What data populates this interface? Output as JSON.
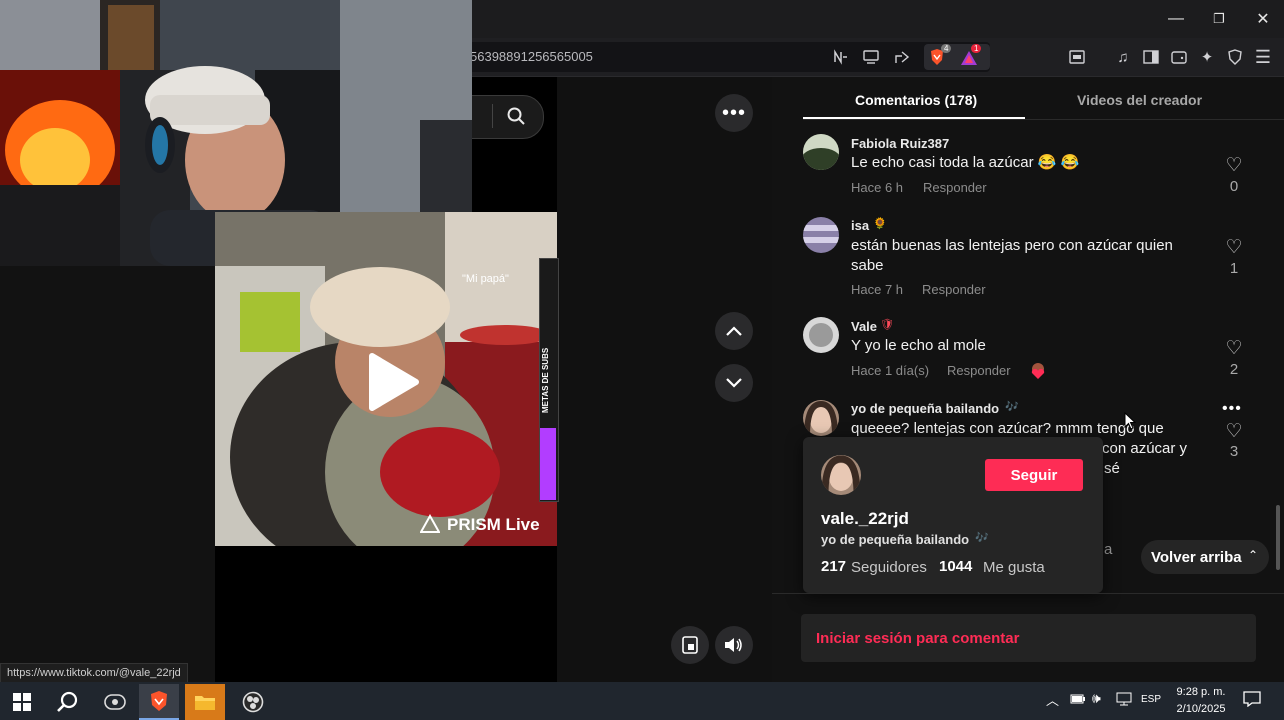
{
  "browser": {
    "url_fragment": "56398891256565005",
    "shields_badge": "4",
    "rewards_badge": "1",
    "window_controls": {
      "minimize": "—",
      "maximize": "❐",
      "close": "✕"
    }
  },
  "video": {
    "overlay_caption": "\"Mi papá\"",
    "side_banner": "METAS DE SUBS",
    "watermark": "PRISM Live"
  },
  "comments_panel": {
    "tabs": [
      {
        "label": "Comentarios (178)",
        "active": true
      },
      {
        "label": "Videos del creador",
        "active": false
      }
    ],
    "comments": [
      {
        "user": "Fabiola Ruiz387",
        "badge": "",
        "text": "Le echo casi toda la azúcar 😂 😂",
        "time": "Hace 6 h",
        "reply": "Responder",
        "likes": "0"
      },
      {
        "user": "isa",
        "badge": "🌻",
        "text": "están buenas las lentejas pero con azúcar quien sabe",
        "time": "Hace 7 h",
        "reply": "Responder",
        "likes": "1"
      },
      {
        "user": "Vale",
        "badge": "🛡",
        "text": "Y yo le echo al mole",
        "time": "Hace 1 día(s)",
        "reply": "Responder",
        "likes": "2"
      },
      {
        "user": "yo de pequeña bailando",
        "badge": "🎶",
        "text": "queeee? lentejas con azúcar? mmm tengo que",
        "text2": "con azúcar y",
        "text3": "sé",
        "likes": "3"
      }
    ],
    "partial_behind_card": "a",
    "back_to_top": "Volver arriba",
    "login_prompt": "Iniciar sesión para comentar"
  },
  "profile_card": {
    "username": "vale._22rjd",
    "nickname": "yo de pequeña bailando",
    "nickname_badge": "🎶",
    "follow_label": "Seguir",
    "followers_count": "217",
    "followers_label": "Seguidores",
    "likes_count": "1044",
    "likes_label": "Me gusta"
  },
  "status_bar": {
    "link": "https://www.tiktok.com/@vale_22rjd"
  },
  "taskbar": {
    "language": "ESP",
    "time": "9:28 p. m.",
    "date": "2/10/2025"
  },
  "colors": {
    "accent_pink": "#fe2c55",
    "panel_bg": "#121212",
    "taskbar_bg": "#20262e"
  }
}
